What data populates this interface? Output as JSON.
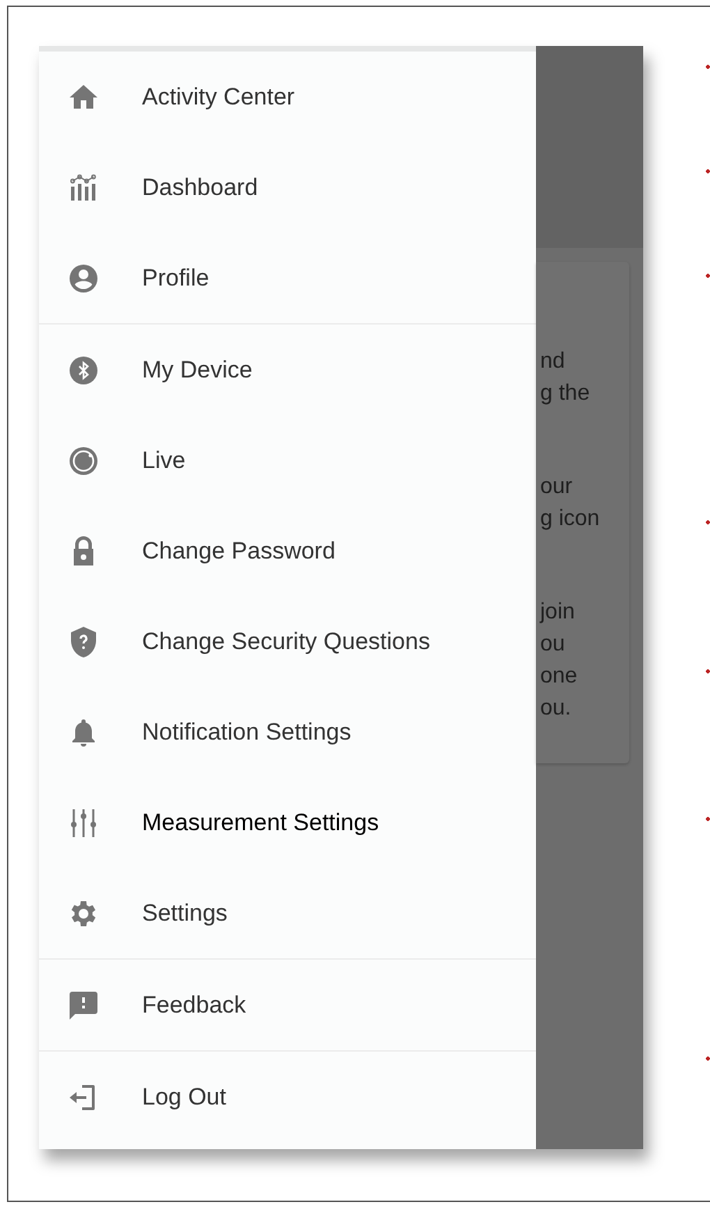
{
  "drawer": {
    "sections": [
      {
        "items": [
          {
            "label": "Activity Center",
            "selected": false
          },
          {
            "label": "Dashboard",
            "selected": false
          },
          {
            "label": "Profile",
            "selected": false
          }
        ]
      },
      {
        "items": [
          {
            "label": "My Device",
            "selected": false
          },
          {
            "label": "Live",
            "selected": false
          },
          {
            "label": "Change Password",
            "selected": false
          },
          {
            "label": "Change Security Questions",
            "selected": false
          },
          {
            "label": "Notification Settings",
            "selected": false
          },
          {
            "label": "Measurement Settings",
            "selected": true
          },
          {
            "label": "Settings",
            "selected": false
          }
        ]
      },
      {
        "items": [
          {
            "label": "Feedback",
            "selected": false
          }
        ]
      },
      {
        "items": [
          {
            "label": "Log Out",
            "selected": false
          }
        ]
      }
    ]
  },
  "background": {
    "card_paragraphs": [
      {
        "lines": [
          "nd",
          "g the"
        ]
      },
      {
        "lines": [
          "our",
          "g icon"
        ]
      },
      {
        "lines": [
          "join",
          "ou",
          "one",
          "ou."
        ]
      }
    ]
  }
}
